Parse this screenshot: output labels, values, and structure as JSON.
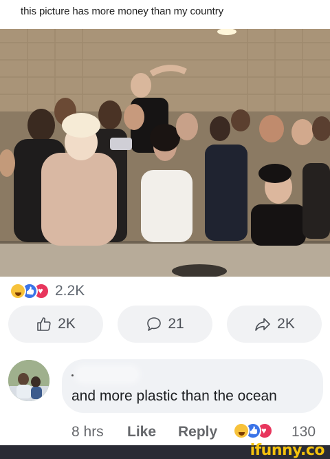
{
  "caption": "this picture has more money than my country",
  "post": {
    "reaction_total": "2.2K",
    "reaction_types": [
      "haha-icon",
      "like-icon",
      "love-icon"
    ]
  },
  "actions": {
    "like_count": "2K",
    "comment_count": "21",
    "share_count": "2K"
  },
  "comment": {
    "text": "and more plastic than the ocean",
    "time": "8 hrs",
    "like_label": "Like",
    "reply_label": "Reply",
    "reaction_count": "130"
  },
  "watermark": "ifunny.co",
  "colors": {
    "button_bg": "#f1f2f4",
    "bubble_bg": "#f0f2f5",
    "muted_text": "#65676b",
    "watermark": "#f4c20d",
    "footer": "#2a2b35"
  }
}
